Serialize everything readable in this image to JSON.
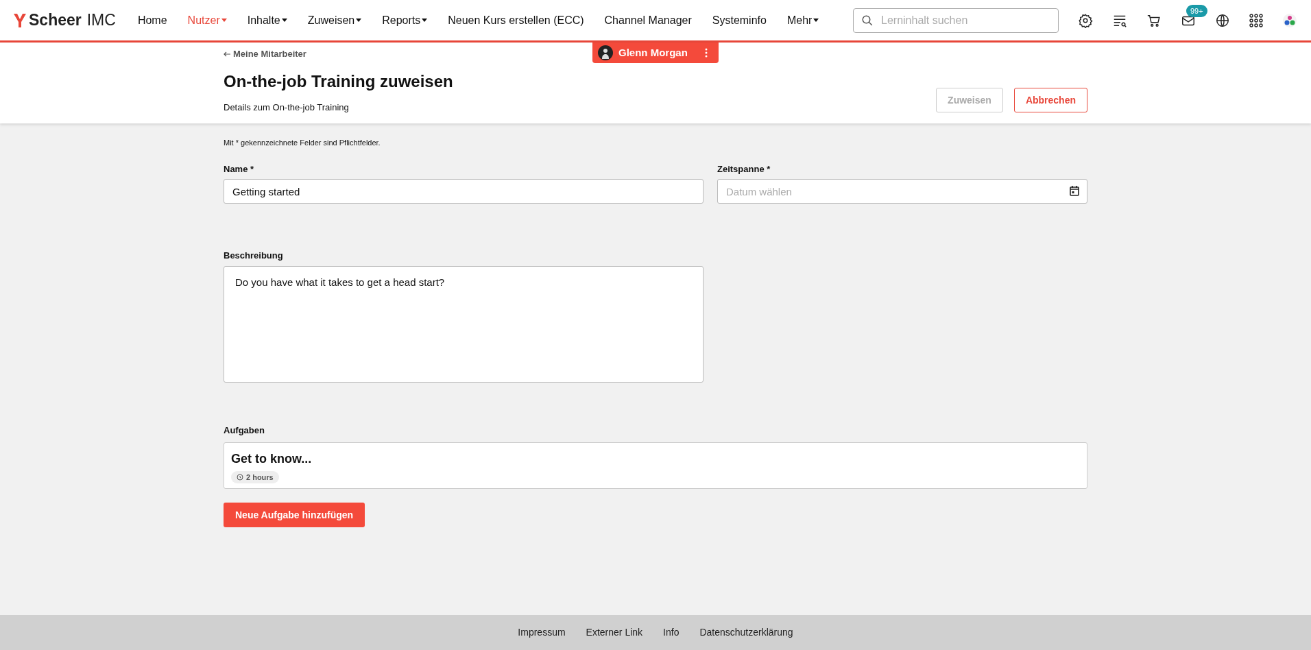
{
  "brand": {
    "name": "Scheer",
    "suffix": "IMC"
  },
  "nav": [
    {
      "label": "Home",
      "selected": false,
      "dropdown": false
    },
    {
      "label": "Nutzer",
      "selected": true,
      "dropdown": true
    },
    {
      "label": "Inhalte",
      "selected": false,
      "dropdown": true
    },
    {
      "label": "Zuweisen",
      "selected": false,
      "dropdown": true
    },
    {
      "label": "Reports",
      "selected": false,
      "dropdown": true
    },
    {
      "label": "Neuen Kurs erstellen (ECC)",
      "selected": false,
      "dropdown": false
    },
    {
      "label": "Channel Manager",
      "selected": false,
      "dropdown": false
    },
    {
      "label": "Systeminfo",
      "selected": false,
      "dropdown": false
    },
    {
      "label": "Mehr",
      "selected": false,
      "dropdown": true
    }
  ],
  "search": {
    "placeholder": "Lerninhalt suchen"
  },
  "toolbar": [
    {
      "kind": "settings"
    },
    {
      "kind": "list"
    },
    {
      "kind": "cart"
    },
    {
      "kind": "mail",
      "badge": "99+"
    },
    {
      "kind": "globe"
    },
    {
      "kind": "apps"
    },
    {
      "kind": "avatar"
    }
  ],
  "user_chip": {
    "name": "Glenn Morgan"
  },
  "back_link": "Meine Mitarbeiter",
  "title": "On-the-job Training zuweisen",
  "subtitle": "Details zum On-the-job Training",
  "actions": [
    {
      "label": "Zuweisen",
      "disabled": true,
      "kind": "primary"
    },
    {
      "label": "Abbrechen",
      "disabled": false,
      "kind": "cancel"
    }
  ],
  "required_note": "Mit * gekennzeichnete Felder sind Pflichtfelder.",
  "fields": {
    "name": {
      "label": "Name *",
      "value": "Getting started"
    },
    "period": {
      "label": "Zeitspanne *",
      "placeholder": "Datum wählen"
    },
    "description": {
      "label": "Beschreibung",
      "value": "Do you have what it takes to get a head start?"
    }
  },
  "tasks": {
    "label": "Aufgaben",
    "items": [
      {
        "title": "Get to know...",
        "duration": "2 hours"
      }
    ],
    "add_button": "Neue Aufgabe hinzufügen"
  },
  "footer": [
    "Impressum",
    "Externer Link",
    "Info",
    "Datenschutzerklärung"
  ]
}
